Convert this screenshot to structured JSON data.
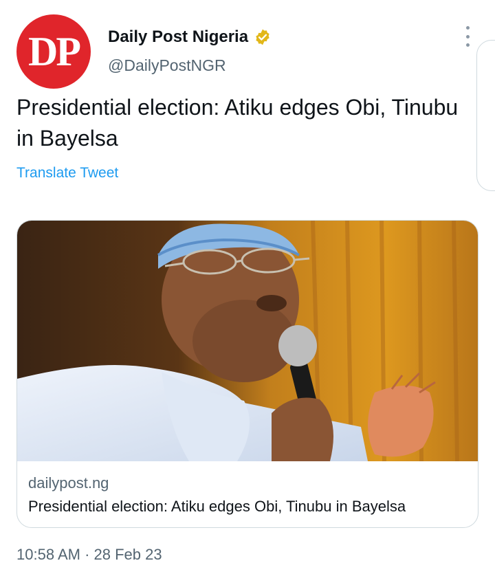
{
  "author": {
    "avatar_text": "DP",
    "name": "Daily Post Nigeria",
    "handle": "@DailyPostNGR",
    "brand_color": "#e0252b",
    "verified_color": "#e2b719"
  },
  "tweet": {
    "text": "Presidential election: Atiku edges Obi, Tinubu in Bayelsa",
    "translate_label": "Translate Tweet",
    "link_color": "#1d9bf0"
  },
  "card": {
    "domain": "dailypost.ng",
    "title": "Presidential election: Atiku edges Obi, Tinubu in Bayelsa",
    "image_icon": "photo-of-man-speaking-into-microphone"
  },
  "meta": {
    "timestamp": "10:58 AM · 28 Feb 23"
  },
  "icons": {
    "more": "more-vertical-icon",
    "verified": "verified-badge-icon"
  }
}
